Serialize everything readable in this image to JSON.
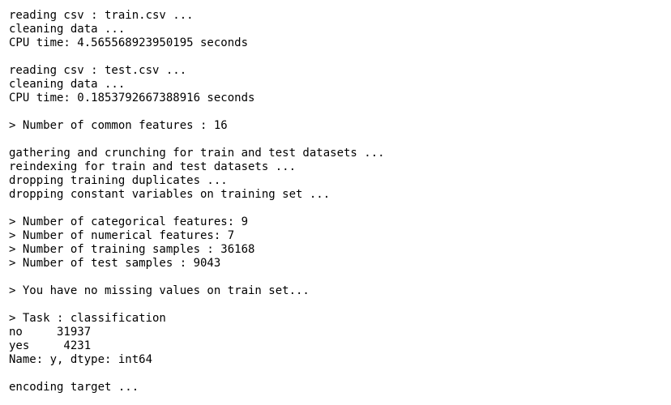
{
  "output": {
    "lines": [
      "reading csv : train.csv ...",
      "cleaning data ...",
      "CPU time: 4.565568923950195 seconds",
      "",
      "reading csv : test.csv ...",
      "cleaning data ...",
      "CPU time: 0.1853792667388916 seconds",
      "",
      "> Number of common features : 16",
      "",
      "gathering and crunching for train and test datasets ...",
      "reindexing for train and test datasets ...",
      "dropping training duplicates ...",
      "dropping constant variables on training set ...",
      "",
      "> Number of categorical features: 9",
      "> Number of numerical features: 7",
      "> Number of training samples : 36168",
      "> Number of test samples : 9043",
      "",
      "> You have no missing values on train set...",
      "",
      "> Task : classification",
      "no     31937",
      "yes     4231",
      "Name: y, dtype: int64",
      "",
      "encoding target ..."
    ]
  }
}
